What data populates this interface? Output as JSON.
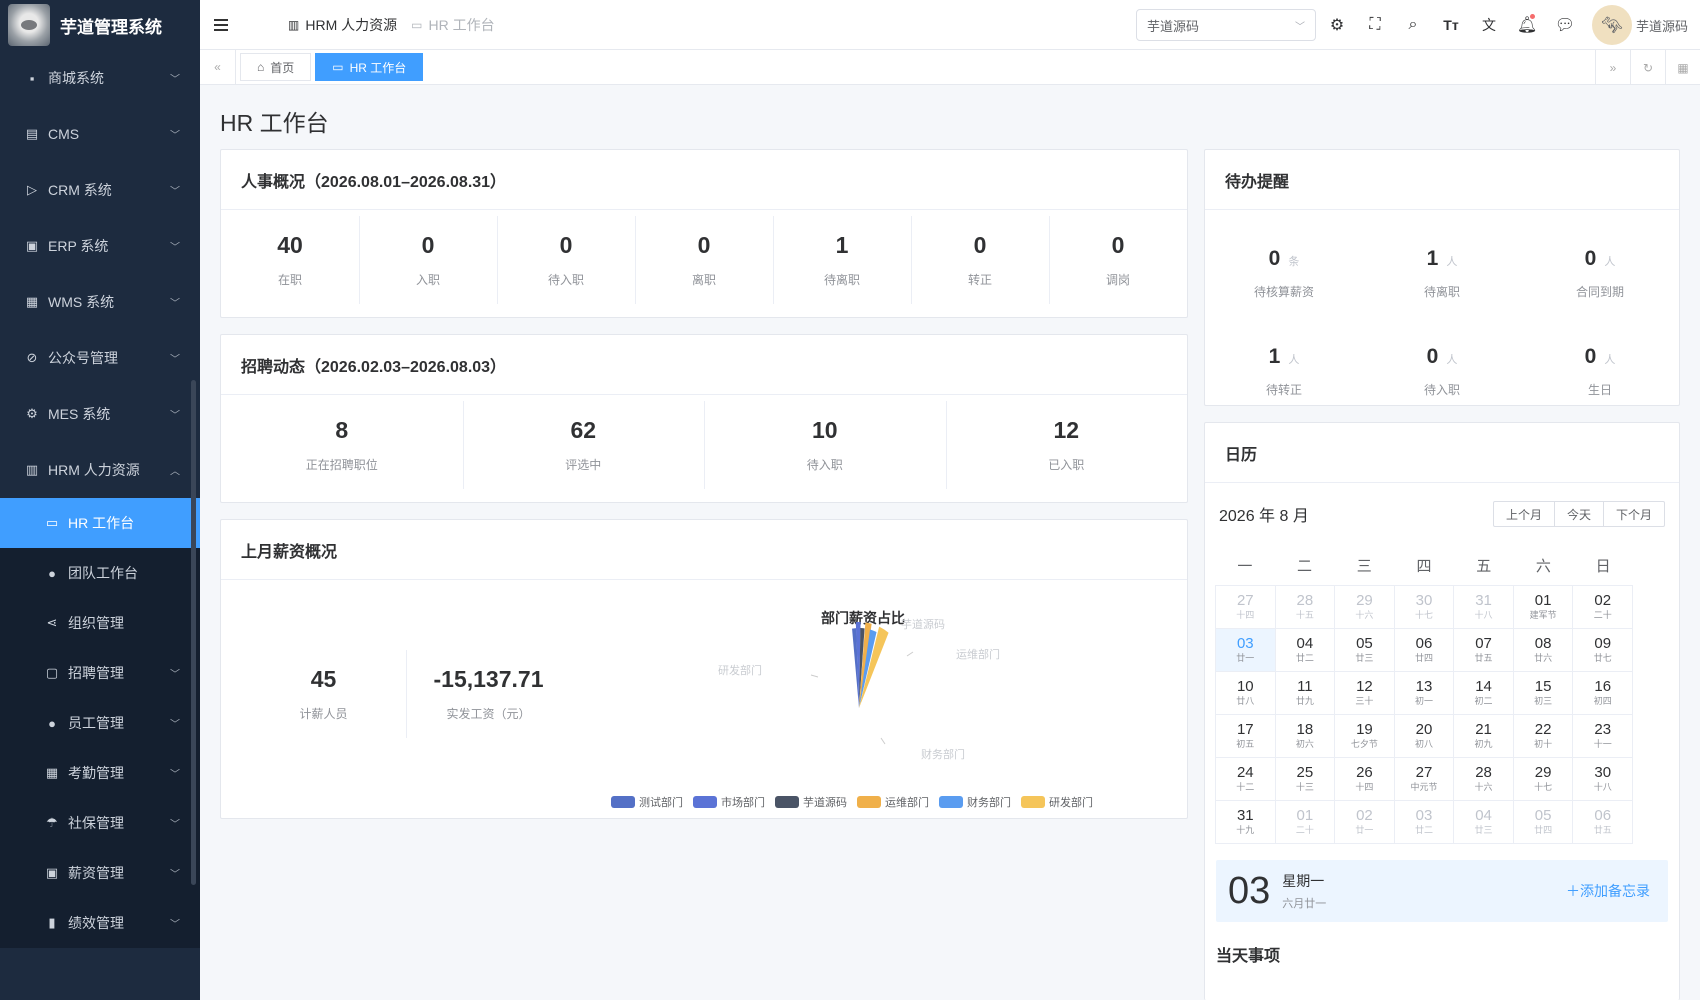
{
  "app": {
    "title": "芋道管理系统"
  },
  "sidebar": {
    "items": [
      {
        "label": "商城系统",
        "icon": "shop-icon"
      },
      {
        "label": "CMS",
        "icon": "document-icon"
      },
      {
        "label": "CRM 系统",
        "icon": "tag-icon"
      },
      {
        "label": "ERP 系统",
        "icon": "erp-icon"
      },
      {
        "label": "WMS 系统",
        "icon": "warehouse-icon"
      },
      {
        "label": "公众号管理",
        "icon": "compass-icon"
      },
      {
        "label": "MES 系统",
        "icon": "gear-icon"
      },
      {
        "label": "HRM 人力资源",
        "icon": "building-icon"
      }
    ],
    "sub": [
      {
        "label": "HR 工作台"
      },
      {
        "label": "团队工作台"
      },
      {
        "label": "组织管理"
      },
      {
        "label": "招聘管理"
      },
      {
        "label": "员工管理"
      },
      {
        "label": "考勤管理"
      },
      {
        "label": "社保管理"
      },
      {
        "label": "薪资管理"
      },
      {
        "label": "绩效管理"
      }
    ]
  },
  "header": {
    "crumb1": "HRM 人力资源",
    "crumb2": "HR 工作台",
    "tenant": "芋道源码",
    "user": "芋道源码"
  },
  "tabs": [
    {
      "label": "首页"
    },
    {
      "label": "HR 工作台"
    }
  ],
  "page": {
    "title": "HR 工作台"
  },
  "overview": {
    "title": "人事概况（2026.08.01–2026.08.31）",
    "stats": [
      {
        "value": "40",
        "label": "在职"
      },
      {
        "value": "0",
        "label": "入职"
      },
      {
        "value": "0",
        "label": "待入职"
      },
      {
        "value": "0",
        "label": "离职"
      },
      {
        "value": "1",
        "label": "待离职"
      },
      {
        "value": "0",
        "label": "转正"
      },
      {
        "value": "0",
        "label": "调岗"
      }
    ]
  },
  "recruit": {
    "title": "招聘动态（2026.02.03–2026.08.03）",
    "stats": [
      {
        "value": "8",
        "label": "正在招聘职位"
      },
      {
        "value": "62",
        "label": "评选中"
      },
      {
        "value": "10",
        "label": "待入职"
      },
      {
        "value": "12",
        "label": "已入职"
      }
    ]
  },
  "payroll": {
    "title": "上月薪资概况",
    "stats": [
      {
        "value": "45",
        "label": "计薪人员"
      },
      {
        "value": "-15,137.71",
        "label": "实发工资（元）"
      }
    ]
  },
  "chart_data": {
    "type": "pie",
    "title": "部门薪资占比",
    "categories": [
      "测试部门",
      "市场部门",
      "芋道源码",
      "运维部门",
      "财务部门",
      "研发部门"
    ],
    "colors": [
      "#5470c6",
      "#5b73d6",
      "#4a5466",
      "#f0b04a",
      "#5a9cf0",
      "#f5c55a"
    ],
    "slice_labels": [
      "芋道源码",
      "运维部门",
      "研发部门",
      "财务部门"
    ]
  },
  "todo": {
    "title": "待办提醒",
    "items": [
      {
        "value": "0",
        "unit": "条",
        "label": "待核算薪资"
      },
      {
        "value": "1",
        "unit": "人",
        "label": "待离职"
      },
      {
        "value": "0",
        "unit": "人",
        "label": "合同到期"
      },
      {
        "value": "1",
        "unit": "人",
        "label": "待转正"
      },
      {
        "value": "0",
        "unit": "人",
        "label": "待入职"
      },
      {
        "value": "0",
        "unit": "人",
        "label": "生日"
      }
    ]
  },
  "calendar": {
    "title": "日历",
    "month": "2026 年 8 月",
    "prev": "上个月",
    "today": "今天",
    "next": "下个月",
    "weekdays": [
      "一",
      "二",
      "三",
      "四",
      "五",
      "六",
      "日"
    ],
    "days": [
      {
        "n": "27",
        "s": "十四",
        "o": true
      },
      {
        "n": "28",
        "s": "十五",
        "o": true
      },
      {
        "n": "29",
        "s": "十六",
        "o": true
      },
      {
        "n": "30",
        "s": "十七",
        "o": true
      },
      {
        "n": "31",
        "s": "十八",
        "o": true
      },
      {
        "n": "01",
        "s": "建军节"
      },
      {
        "n": "02",
        "s": "二十"
      },
      {
        "n": "03",
        "s": "廿一",
        "sel": true
      },
      {
        "n": "04",
        "s": "廿二"
      },
      {
        "n": "05",
        "s": "廿三"
      },
      {
        "n": "06",
        "s": "廿四"
      },
      {
        "n": "07",
        "s": "廿五"
      },
      {
        "n": "08",
        "s": "廿六"
      },
      {
        "n": "09",
        "s": "廿七"
      },
      {
        "n": "10",
        "s": "廿八"
      },
      {
        "n": "11",
        "s": "廿九"
      },
      {
        "n": "12",
        "s": "三十"
      },
      {
        "n": "13",
        "s": "初一"
      },
      {
        "n": "14",
        "s": "初二"
      },
      {
        "n": "15",
        "s": "初三"
      },
      {
        "n": "16",
        "s": "初四"
      },
      {
        "n": "17",
        "s": "初五"
      },
      {
        "n": "18",
        "s": "初六"
      },
      {
        "n": "19",
        "s": "七夕节"
      },
      {
        "n": "20",
        "s": "初八"
      },
      {
        "n": "21",
        "s": "初九"
      },
      {
        "n": "22",
        "s": "初十"
      },
      {
        "n": "23",
        "s": "十一"
      },
      {
        "n": "24",
        "s": "十二"
      },
      {
        "n": "25",
        "s": "十三"
      },
      {
        "n": "26",
        "s": "十四"
      },
      {
        "n": "27",
        "s": "中元节"
      },
      {
        "n": "28",
        "s": "十六"
      },
      {
        "n": "29",
        "s": "十七"
      },
      {
        "n": "30",
        "s": "十八"
      },
      {
        "n": "31",
        "s": "十九"
      },
      {
        "n": "01",
        "s": "二十",
        "o": true
      },
      {
        "n": "02",
        "s": "廿一",
        "o": true
      },
      {
        "n": "03",
        "s": "廿二",
        "o": true
      },
      {
        "n": "04",
        "s": "廿三",
        "o": true
      },
      {
        "n": "05",
        "s": "廿四",
        "o": true
      },
      {
        "n": "06",
        "s": "廿五",
        "o": true
      }
    ],
    "memo_day": "03",
    "memo_week": "星期一",
    "memo_lunar": "六月廿一",
    "memo_add": "添加备忘录",
    "today_title": "当天事项"
  }
}
